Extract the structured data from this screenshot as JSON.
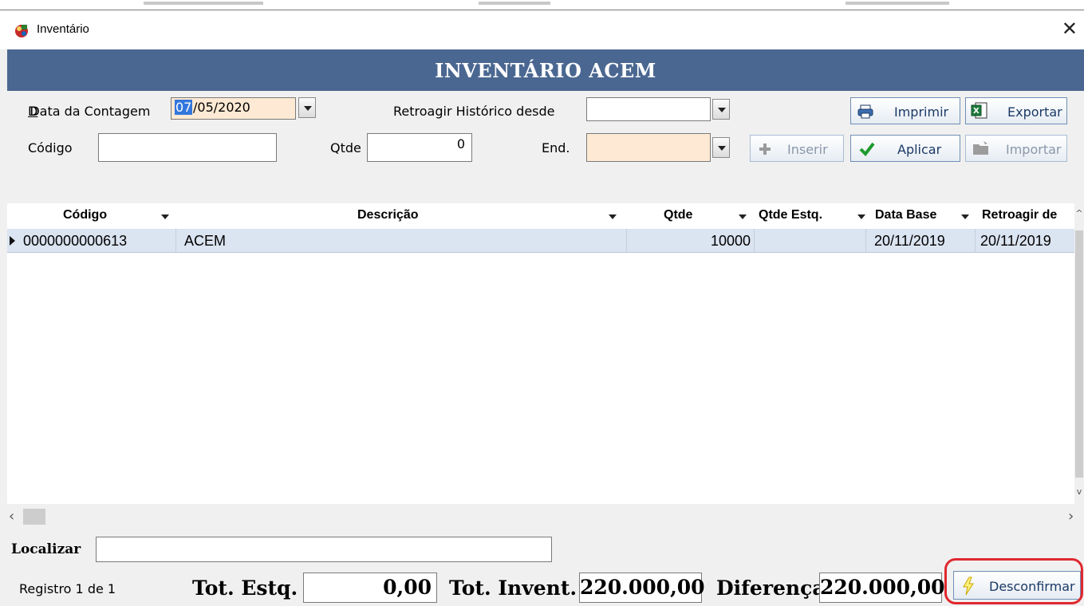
{
  "window": {
    "title": "Inventário"
  },
  "header": {
    "title": "INVENTÁRIO ACEM"
  },
  "form": {
    "data_contagem_label": "Data da Contagem",
    "data_contagem_selected": "07",
    "data_contagem_rest": "/05/2020",
    "retroagir_label": "Retroagir Histórico desde",
    "retroagir_value": "",
    "codigo_label": "Código",
    "codigo_value": "",
    "qtde_label": "Qtde",
    "qtde_value": "0",
    "end_label": "End.",
    "end_value": ""
  },
  "buttons": {
    "imprimir": "Imprimir",
    "exportar": "Exportar",
    "inserir": "Inserir",
    "aplicar": "Aplicar",
    "importar": "Importar",
    "desconfirmar": "Desconfirmar"
  },
  "grid": {
    "columns": [
      "Código",
      "Descrição",
      "Qtde",
      "Qtde Estq.",
      "Data Base",
      "Retroagir de"
    ],
    "rows": [
      {
        "codigo": "0000000000613",
        "descricao": "ACEM",
        "qtde": "10000",
        "qtde_estq": "",
        "data_base": "20/11/2019",
        "retroagir": "20/11/2019"
      }
    ]
  },
  "footer": {
    "localizar_label": "Localizar",
    "localizar_value": "",
    "registro": "Registro 1 de 1",
    "tot_estq_label": "Tot. Estq.",
    "tot_estq_value": "0,00",
    "tot_invent_label": "Tot. Invent.",
    "tot_invent_value": "220.000,00",
    "diferenca_label": "Diferença",
    "diferenca_value": "220.000,00"
  },
  "colors": {
    "header_band": "#4a6791",
    "selected_row": "#dbe4f1",
    "date_field_bg": "#fde9d4",
    "highlight_ring": "#e0282f"
  },
  "icons": [
    "app-icon",
    "close-icon",
    "printer-icon",
    "excel-icon",
    "plus-icon",
    "check-icon",
    "folder-icon",
    "lightning-icon"
  ]
}
